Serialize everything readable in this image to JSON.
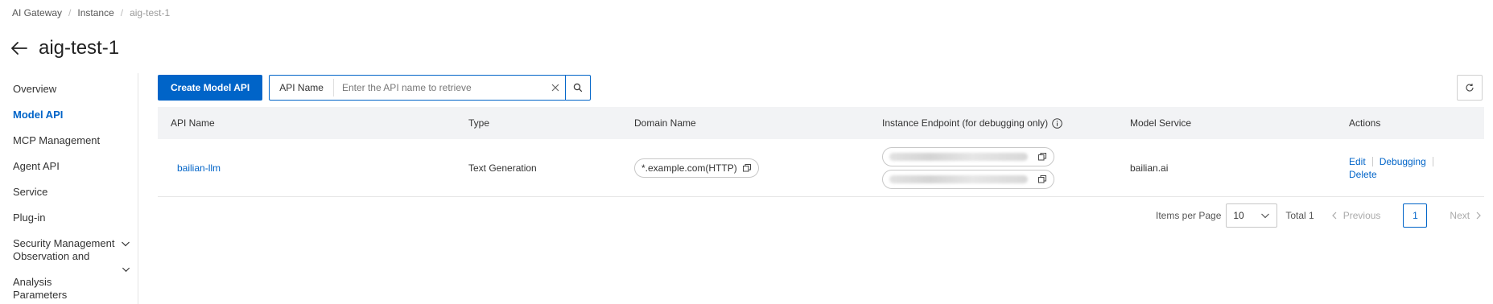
{
  "breadcrumb": {
    "items": [
      "AI Gateway",
      "Instance",
      "aig-test-1"
    ]
  },
  "header": {
    "title": "aig-test-1"
  },
  "sidebar": {
    "items": [
      {
        "label": "Overview"
      },
      {
        "label": "Model API",
        "active": true
      },
      {
        "label": "MCP Management"
      },
      {
        "label": "Agent API"
      },
      {
        "label": "Service"
      },
      {
        "label": "Plug-in"
      },
      {
        "label": "Security Management",
        "expandable": true
      },
      {
        "label": "Observation and Analysis",
        "expandable": true
      },
      {
        "label": "Parameters"
      }
    ]
  },
  "toolbar": {
    "create_label": "Create Model API",
    "search_label": "API Name",
    "search_placeholder": "Enter the API name to retrieve",
    "search_value": ""
  },
  "table": {
    "columns": [
      "API Name",
      "Type",
      "Domain Name",
      "Instance Endpoint (for debugging only)",
      "Model Service",
      "Actions"
    ],
    "rows": [
      {
        "api_name": "bailian-llm",
        "type": "Text Generation",
        "domain": "*.example.com(HTTP)",
        "model_service": "bailian.ai",
        "actions": [
          "Edit",
          "Debugging",
          "Delete"
        ]
      }
    ]
  },
  "pagination": {
    "items_per_page_label": "Items per Page",
    "page_size": "10",
    "total_label": "Total 1",
    "prev_label": "Previous",
    "next_label": "Next",
    "current_page": "1"
  },
  "colors": {
    "primary": "#0064c8",
    "header_bg": "#f2f3f5"
  }
}
